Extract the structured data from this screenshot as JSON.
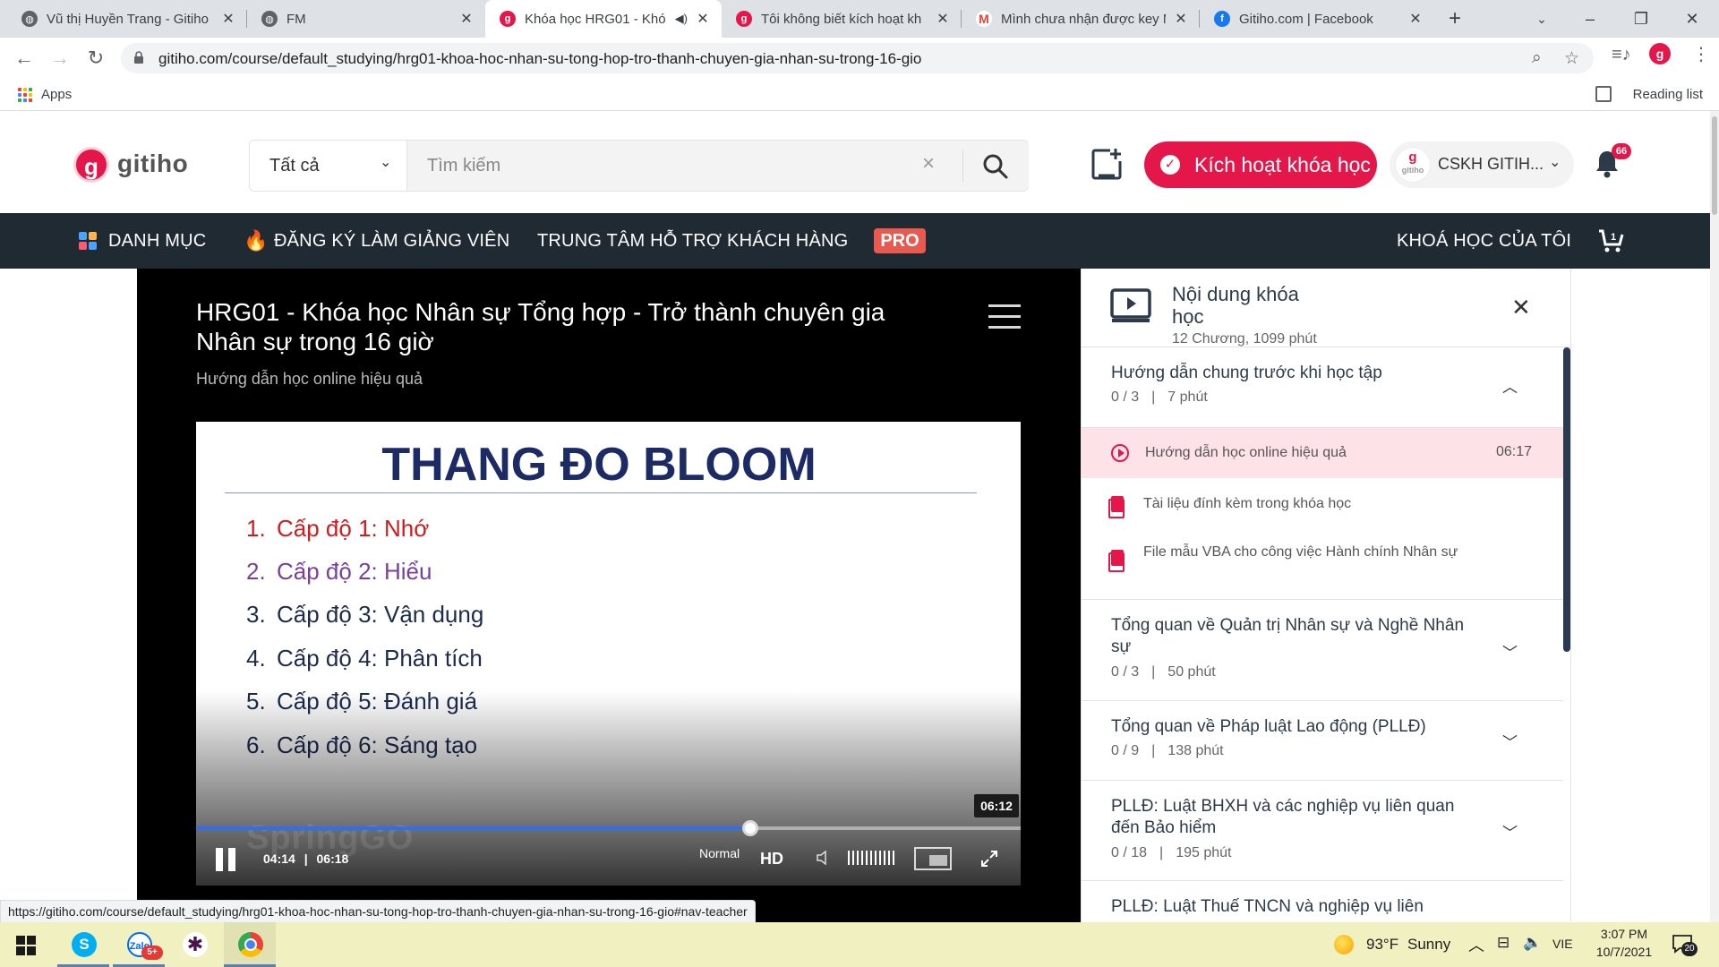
{
  "browser": {
    "tabs": [
      {
        "title": "Vũ thị Huyền Trang - Gitiho",
        "favicon": "globe-icon",
        "active": false
      },
      {
        "title": "FM",
        "favicon": "globe-icon",
        "active": false
      },
      {
        "title": "Khóa học HRG01 - Khó",
        "favicon": "gitiho-icon",
        "active": true,
        "audio": true
      },
      {
        "title": "Tôi không biết kích hoạt kh",
        "favicon": "gitiho-icon",
        "active": false
      },
      {
        "title": "Mình chưa nhận được key M",
        "favicon": "gmail-icon",
        "active": false
      },
      {
        "title": "Gitiho.com | Facebook",
        "favicon": "facebook-icon",
        "active": false
      }
    ],
    "url": "gitiho.com/course/default_studying/hrg01-khoa-hoc-nhan-su-tong-hop-tro-thanh-chuyen-gia-nhan-su-trong-16-gio",
    "bookmarks": {
      "apps": "Apps",
      "reading_list": "Reading list"
    },
    "status_url": "https://gitiho.com/course/default_studying/hrg01-khoa-hoc-nhan-su-tong-hop-tro-thanh-chuyen-gia-nhan-su-trong-16-gio#nav-teacher"
  },
  "header": {
    "logo_text": "gitiho",
    "logo_letter": "g",
    "search_category": "Tất cả",
    "search_placeholder": "Tìm kiếm",
    "activate_label": "Kích hoạt khóa học",
    "user_name": "CSKH GITIH...",
    "avatar_text": "gitiho",
    "notification_count": "66"
  },
  "nav": {
    "catalog": "DANH MỤC",
    "become_teacher": "ĐĂNG KÝ LÀM GIẢNG VIÊN",
    "support": "TRUNG TÂM HỖ TRỢ KHÁCH HÀNG",
    "pro": "PRO",
    "my_courses": "KHOÁ HỌC CỦA TÔI"
  },
  "lesson": {
    "course_title": "HRG01 - Khóa học Nhân sự Tổng hợp - Trở thành chuyên gia Nhân sự trong 16 giờ",
    "current_lesson": "Hướng dẫn học online hiệu quả"
  },
  "slide": {
    "title": "THANG ĐO BLOOM",
    "items": [
      {
        "num": "1.",
        "text": "Cấp độ 1: Nhớ",
        "color": "#d7191c"
      },
      {
        "num": "2.",
        "text": "Cấp độ 2: Hiểu",
        "color": "#7a3fa0"
      },
      {
        "num": "3.",
        "text": "Cấp độ 3: Vận dụng",
        "color": "#1c2b4f"
      },
      {
        "num": "4.",
        "text": "Cấp độ 4: Phân tích",
        "color": "#1c2b4f"
      },
      {
        "num": "5.",
        "text": "Cấp độ 5: Đánh giá",
        "color": "#1c2b4f"
      },
      {
        "num": "6.",
        "text": "Cấp độ 6: Sáng tạo",
        "color": "#1c2b4f"
      }
    ],
    "watermark": "SpringGO"
  },
  "player": {
    "current_time": "04:14",
    "separator": "|",
    "duration": "06:18",
    "hover_time": "06:12",
    "progress": 0.672,
    "speed_label": "Normal",
    "quality_label": "HD"
  },
  "course_panel": {
    "title": "Nội dung khóa học",
    "meta": "12 Chương, 1099 phút",
    "chapters": [
      {
        "title": "Hướng dẫn chung trước khi học tập",
        "progress": "0 / 3",
        "sep": "|",
        "duration": "7 phút",
        "expanded": true
      },
      {
        "title": "Tổng quan về Quản trị Nhân sự và Nghề Nhân sự",
        "progress": "0 / 3",
        "sep": "|",
        "duration": "50 phút",
        "expanded": false
      },
      {
        "title": "Tổng quan về Pháp luật Lao động (PLLĐ)",
        "progress": "0 / 9",
        "sep": "|",
        "duration": "138 phút",
        "expanded": false
      },
      {
        "title": "PLLĐ: Luật BHXH và các nghiệp vụ liên quan đến Bảo hiểm",
        "progress": "0 / 18",
        "sep": "|",
        "duration": "195 phút",
        "expanded": false
      },
      {
        "title": "PLLĐ: Luật Thuế TNCN và nghiệp vụ liên"
      }
    ],
    "lessons": [
      {
        "title": "Hướng dẫn học online hiệu quả",
        "duration": "06:17",
        "type": "video",
        "active": true
      },
      {
        "title": "Tài liệu đính kèm trong khóa học",
        "type": "document"
      },
      {
        "title": "File mẫu VBA cho công việc Hành chính Nhân sự",
        "type": "document"
      }
    ]
  },
  "taskbar": {
    "temperature": "93°F",
    "weather": "Sunny",
    "language": "VIE",
    "time": "3:07 PM",
    "date": "10/7/2021",
    "notification_count": "20",
    "zalo_badge": "5+"
  },
  "colors": {
    "brand": "#e5164a",
    "nav_bg": "#1f2a32",
    "active_lesson_bg": "#fde2e8",
    "progress": "#2f6df2"
  }
}
